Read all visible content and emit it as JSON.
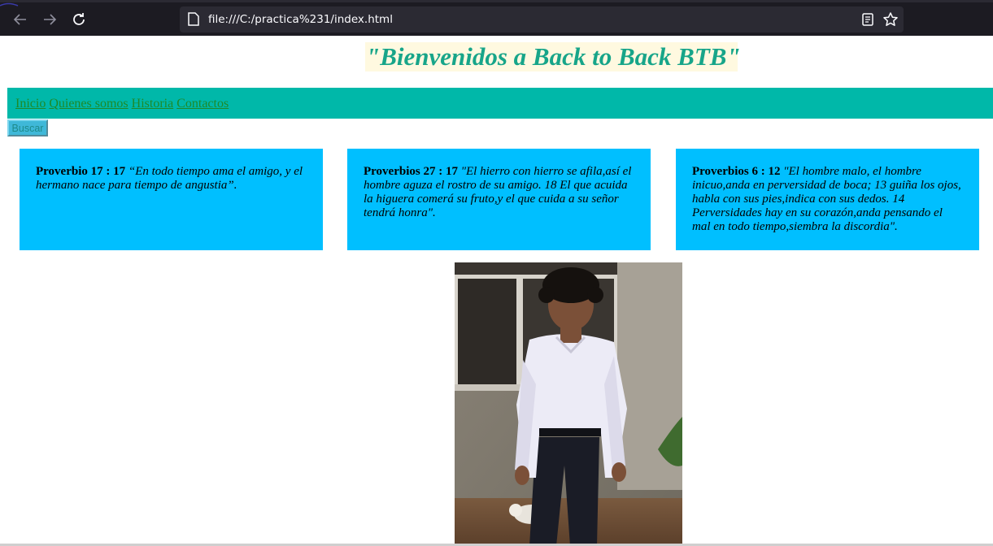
{
  "browser": {
    "url": "file:///C:/practica%231/index.html",
    "icons": [
      "back-arrow-icon",
      "forward-arrow-icon",
      "reload-icon",
      "page-icon",
      "reader-view-icon",
      "bookmark-star-icon"
    ]
  },
  "page": {
    "title": "\"Bienvenidos a Back to Back BTB\"",
    "nav": {
      "links": [
        "Inicio",
        "Quienes somos",
        "Historia",
        "Contactos"
      ]
    },
    "search_label": "Buscar",
    "cards": [
      {
        "ref": "Proverbio 17 : 17",
        "text": "“En todo tiempo ama el amigo, y el hermano nace para tiempo de angustia”."
      },
      {
        "ref": "Proverbios 27 : 17",
        "text": "\"El hierro con hierro se afila,así el hombre aguza el rostro de su amigo. 18 El que acuida la higuera comerá su fruto,y el que cuida a su señor tendrá honra\"."
      },
      {
        "ref": "Proverbios 6 : 12",
        "text": "\"El hombre malo, el hombre inicuo,anda en perversidad de boca; 13 guiña los ojos, habla con sus pies,indica con sus dedos. 14 Perversidades hay en su corazón,anda pensando el mal en todo tiempo,siembra la discordia\"."
      }
    ]
  },
  "colors": {
    "title": "#17a589",
    "title_bg": "#fff9e0",
    "navbar": "#00b8a9",
    "link": "#1e8a2a",
    "card": "#00bfff"
  }
}
